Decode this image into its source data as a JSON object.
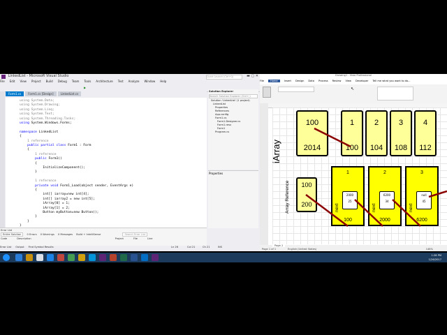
{
  "vs": {
    "title": "LinkedList - Microsoft Visual Studio",
    "quick_launch": "Quick Launch (Ctrl+Q)",
    "menu": [
      "File",
      "Edit",
      "View",
      "Project",
      "Build",
      "Debug",
      "Team",
      "Tools",
      "Architecture",
      "Test",
      "Analyze",
      "Window",
      "Help"
    ],
    "tabs": [
      "Form1.cs",
      "Form1.cs [Design]",
      "LinkedList.cs"
    ],
    "code_lines": [
      {
        "k": "using",
        "t": " System.Data;",
        "g": true
      },
      {
        "k": "using",
        "t": " System.Drawing;",
        "g": true
      },
      {
        "k": "using",
        "t": " System.Linq;",
        "g": true
      },
      {
        "k": "using",
        "t": " System.Text;",
        "g": true
      },
      {
        "k": "using",
        "t": " System.Threading.Tasks;",
        "g": true
      },
      {
        "k": "using",
        "t": " System.Windows.Forms;"
      },
      {
        "k": "",
        "t": ""
      },
      {
        "k": "namespace",
        "t": " LinkedList"
      },
      {
        "k": "",
        "t": "{"
      },
      {
        "k": "",
        "t": "    1 reference",
        "c": true
      },
      {
        "k": "    public partial class",
        "t": " Form1 : Form"
      },
      {
        "k": "",
        "t": "    {"
      },
      {
        "k": "",
        "t": "        1 reference",
        "c": true
      },
      {
        "k": "        public",
        "t": " Form1()"
      },
      {
        "k": "",
        "t": "        {"
      },
      {
        "k": "",
        "t": "            InitializeComponent();"
      },
      {
        "k": "",
        "t": "        }"
      },
      {
        "k": "",
        "t": ""
      },
      {
        "k": "",
        "t": "        1 reference",
        "c": true
      },
      {
        "k": "        private void",
        "t": " Form1_Load(object sender, EventArgs e)"
      },
      {
        "k": "",
        "t": "        {"
      },
      {
        "k": "",
        "t": "            int[] iarray=new int[4];"
      },
      {
        "k": "",
        "t": "            int[] iarray2 = new int[5];"
      },
      {
        "k": "",
        "t": "            iArray[0] = 1;"
      },
      {
        "k": "",
        "t": "            iArray[1] = 2;"
      },
      {
        "k": "",
        "t": "            Button myButton=new Button();"
      },
      {
        "k": "",
        "t": "        }"
      },
      {
        "k": "",
        "t": "    }"
      },
      {
        "k": "",
        "t": "}"
      }
    ],
    "solution_explorer": {
      "title": "Solution Explorer",
      "search": "Search Solution Explorer (Ctrl+;)",
      "items": [
        "Solution 'LinkedList' (1 project)",
        "LinkedList",
        "Properties",
        "References",
        "App.config",
        "Form1.cs",
        "Form1.Designer.cs",
        "Form1.resx",
        "Form1",
        "Program.cs"
      ]
    },
    "properties_title": "Properties",
    "error_list": {
      "title": "Error List",
      "scope": "Entire Solution",
      "errors": "0 Errors",
      "warnings": "0 Warnings",
      "messages": "0 Messages",
      "filter": "Build + IntelliSense",
      "search": "Search Error List",
      "columns": [
        "Code",
        "Description",
        "Project",
        "File",
        "Line"
      ]
    },
    "bottom_tabs": [
      "Error List",
      "Output",
      "Find Symbol Results"
    ],
    "status": {
      "ln": "Ln 26",
      "col": "Col 21",
      "ch": "Ch 21",
      "ins": "INS"
    }
  },
  "visio": {
    "title": "Drawing1 - Visio Professional",
    "tabs": [
      "File",
      "Home",
      "Insert",
      "Design",
      "Data",
      "Process",
      "Review",
      "View",
      "Developer",
      "Tell me what you want to do..."
    ],
    "page_label": "Page-1",
    "status_page": "Page 1 of 1",
    "status_lang": "English (United States)",
    "zoom": "148%",
    "diagram": {
      "iarray_label": "iArray",
      "ref_value": "100",
      "ref_address": "2014",
      "cells": [
        {
          "value": "1",
          "address": "100"
        },
        {
          "value": "2",
          "address": "104"
        },
        {
          "value": "3",
          "address": "108"
        },
        {
          "value": "4",
          "address": "112"
        }
      ],
      "array_ref_label": "Array Reference",
      "list_ref_value": "100",
      "list_ref_address": "200",
      "nodes": [
        {
          "value": "1",
          "next_value": "2000",
          "next_address": "25",
          "address": "100",
          "next_label": "next"
        },
        {
          "value": "2",
          "next_value": "6200",
          "next_address": "34",
          "address": "2000",
          "next_label": "next"
        },
        {
          "value": "3",
          "next_value": "null",
          "next_address": "45",
          "address": "6200",
          "next_label": "next"
        }
      ]
    }
  },
  "taskbar": {
    "time": "1:28 PM",
    "date": "1/26/2017"
  },
  "colors": {
    "vs_accent": "#007acc",
    "visio_accent": "#2b579a",
    "node_fill": "#ffff00",
    "cell_fill": "#ffff99",
    "pointer_line": "#8b0000"
  }
}
